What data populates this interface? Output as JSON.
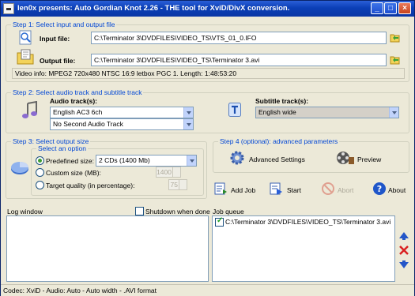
{
  "window": {
    "title": "len0x presents: Auto Gordian Knot 2.26 - THE tool for XviD/DivX conversion."
  },
  "step1": {
    "legend": "Step 1: Select input and output file",
    "input_label": "Input file:",
    "input_value": "C:\\Terminator 3\\DVDFILES\\VIDEO_TS\\VTS_01_0.IFO",
    "output_label": "Output file:",
    "output_value": "C:\\Terminator 3\\DVDFILES\\VIDEO_TS\\Terminator 3.avi",
    "video_info": "Video info: MPEG2 720x480 NTSC 16:9 letbox  PGC 1. Length: 1:48:53:20"
  },
  "step2": {
    "legend": "Step 2: Select audio track and subtitle track",
    "audio_label": "Audio track(s):",
    "audio1": "English AC3 6ch",
    "audio2": "No Second Audio Track",
    "subtitle_label": "Subtitle track(s):",
    "subtitle": "English wide"
  },
  "step3": {
    "legend": "Step 3: Select output size",
    "option_legend": "Select an option",
    "predefined_label": "Predefined size:",
    "predefined_value": "2 CDs (1400 Mb)",
    "custom_label": "Custom size (MB):",
    "custom_value": "1400",
    "quality_label": "Target quality (in percentage):",
    "quality_value": "75"
  },
  "step4": {
    "legend": "Step 4 (optional): advanced parameters",
    "advanced_label": "Advanced Settings",
    "preview_label": "Preview"
  },
  "actions": {
    "add_job": "Add Job",
    "start": "Start",
    "abort": "Abort",
    "about": "About"
  },
  "log": {
    "label": "Log window",
    "shutdown_label": "Shutdown when done"
  },
  "queue": {
    "label": "Job queue",
    "items": [
      "C:\\Terminator 3\\DVDFILES\\VIDEO_TS\\Terminator 3.avi"
    ]
  },
  "status": {
    "text": "Codec: XviD -  Audio: Auto -  Auto width - .AVI format"
  },
  "colors": {
    "legend": "#0046d5",
    "title_bar": "#0a36a5",
    "selection": "#316ac5"
  }
}
